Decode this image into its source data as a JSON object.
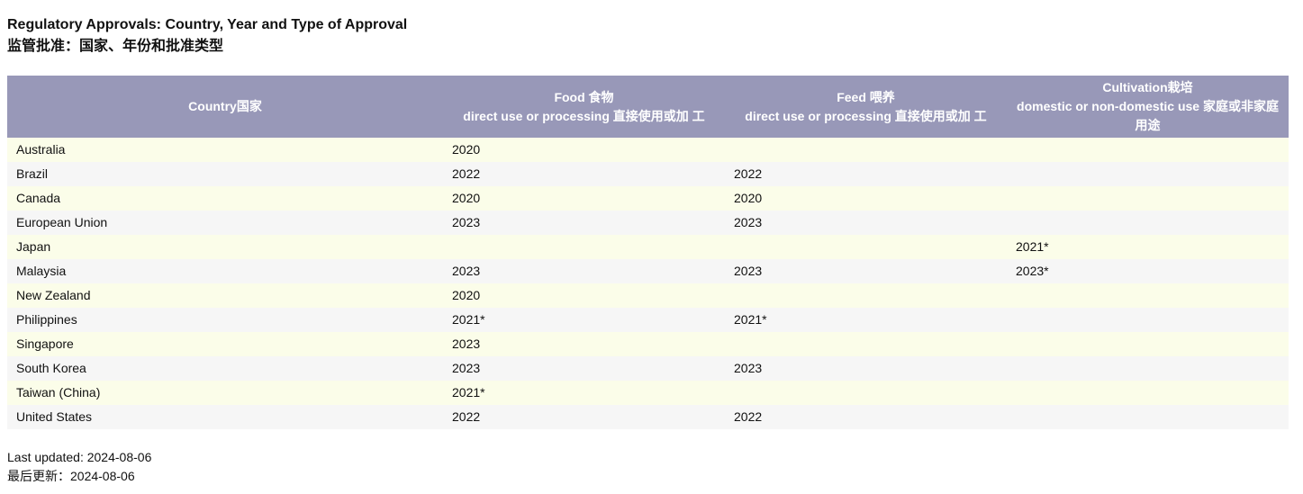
{
  "title": {
    "en": "Regulatory Approvals: Country, Year and Type of Approval",
    "zh": "监管批准：国家、年份和批准类型"
  },
  "table": {
    "headers": {
      "country": "Country国家",
      "food_line1": "Food 食物",
      "food_line2": "direct use or processing 直接使用或加 工",
      "feed_line1": "Feed 喂养",
      "feed_line2": "direct use or processing 直接使用或加 工",
      "cultivation_line1": "Cultivation栽培",
      "cultivation_line2": "domestic or non-domestic use 家庭或非家庭用途"
    },
    "rows": [
      {
        "country": "Australia",
        "food": "2020",
        "feed": "",
        "cultivation": ""
      },
      {
        "country": "Brazil",
        "food": "2022",
        "feed": "2022",
        "cultivation": ""
      },
      {
        "country": "Canada",
        "food": "2020",
        "feed": "2020",
        "cultivation": ""
      },
      {
        "country": "European Union",
        "food": "2023",
        "feed": "2023",
        "cultivation": ""
      },
      {
        "country": "Japan",
        "food": "",
        "feed": "",
        "cultivation": "2021*"
      },
      {
        "country": "Malaysia",
        "food": "2023",
        "feed": "2023",
        "cultivation": "2023*"
      },
      {
        "country": "New Zealand",
        "food": "2020",
        "feed": "",
        "cultivation": ""
      },
      {
        "country": "Philippines",
        "food": "2021*",
        "feed": "2021*",
        "cultivation": ""
      },
      {
        "country": "Singapore",
        "food": "2023",
        "feed": "",
        "cultivation": ""
      },
      {
        "country": "South Korea",
        "food": "2023",
        "feed": "2023",
        "cultivation": ""
      },
      {
        "country": "Taiwan (China)",
        "food": "2021*",
        "feed": "",
        "cultivation": ""
      },
      {
        "country": "United States",
        "food": "2022",
        "feed": "2022",
        "cultivation": ""
      }
    ]
  },
  "footer": {
    "updated_en": "Last updated: 2024-08-06",
    "updated_zh": "最后更新：2024-08-06"
  }
}
